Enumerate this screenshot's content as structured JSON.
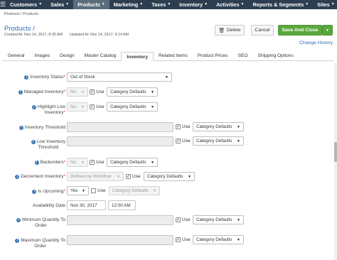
{
  "nav": {
    "items": [
      {
        "label": "Customers"
      },
      {
        "label": "Sales"
      },
      {
        "label": "Products"
      },
      {
        "label": "Marketing"
      },
      {
        "label": "Taxes"
      },
      {
        "label": "Inventory"
      },
      {
        "label": "Activities"
      },
      {
        "label": "Reports & Segments"
      },
      {
        "label": "Sites"
      }
    ],
    "active": "Products"
  },
  "breadcrumb": "Products / Products",
  "page": {
    "title": "Products /",
    "created": "Created At: Nov 14, 2017, 8:35 AM",
    "updated": "Updated At: Nov 14, 2017, 9:14 AM"
  },
  "actions": {
    "delete": "Delete",
    "cancel": "Cancel",
    "save_close": "Save And Close",
    "change_history": "Change History"
  },
  "tabs": [
    "General",
    "Images",
    "Design",
    "Master Catalog",
    "Inventory",
    "Related Items",
    "Product Prices",
    "SEO",
    "Shipping Options"
  ],
  "active_tab": "Inventory",
  "form": {
    "use_label": "Use",
    "category_defaults": "Category Defaults",
    "inventory_status": {
      "label": "Inventory Status",
      "value": "Out of Stock"
    },
    "managed_inventory": {
      "label": "Managed Inventory",
      "value": "No"
    },
    "highlight_low_1": "Highlight Low",
    "highlight_low_2": "Inventory",
    "highlight_low": {
      "value": "No"
    },
    "inventory_threshold": {
      "label": "Inventory Threshold"
    },
    "low_inventory_1": "Low Inventory",
    "low_inventory_2": "Threshold",
    "backorders": {
      "label": "Backorders",
      "value": "No"
    },
    "decrement_inventory": {
      "label": "Decrement Inventory",
      "value": "Defined by Workflow"
    },
    "is_upcoming": {
      "label": "Is Upcoming",
      "value": "Yes"
    },
    "availability_date": {
      "label": "Availability Date",
      "date": "Nov 30, 2017",
      "time": "12:00 AM"
    },
    "min_qty_1": "Minimum Quantity To",
    "min_qty_2": "Order",
    "max_qty_1": "Maximum Quantity To",
    "max_qty_2": "Order"
  },
  "colors": {
    "nav_bg": "#2c3e50",
    "accent": "#2a6ebb",
    "save_green": "#5aa83c"
  }
}
